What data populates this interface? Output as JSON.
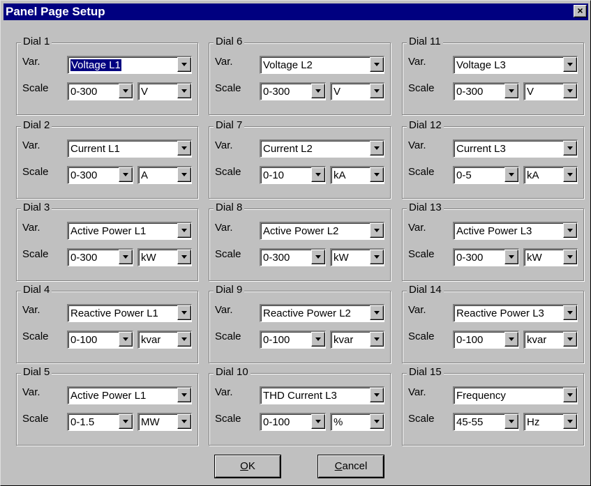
{
  "window": {
    "title": "Panel Page Setup",
    "close_glyph": "×"
  },
  "labels": {
    "var": "Var.",
    "scale": "Scale"
  },
  "dials": [
    {
      "name": "Dial 1",
      "variable": "Voltage L1",
      "range": "0-300",
      "unit": "V",
      "focused": true
    },
    {
      "name": "Dial 2",
      "variable": "Current L1",
      "range": "0-300",
      "unit": "A"
    },
    {
      "name": "Dial 3",
      "variable": "Active Power L1",
      "range": "0-300",
      "unit": "kW"
    },
    {
      "name": "Dial 4",
      "variable": "Reactive Power L1",
      "range": "0-100",
      "unit": "kvar"
    },
    {
      "name": "Dial 5",
      "variable": "Active Power L1",
      "range": "0-1.5",
      "unit": "MW"
    },
    {
      "name": "Dial 6",
      "variable": "Voltage L2",
      "range": "0-300",
      "unit": "V"
    },
    {
      "name": "Dial 7",
      "variable": "Current L2",
      "range": "0-10",
      "unit": "kA"
    },
    {
      "name": "Dial 8",
      "variable": "Active Power L2",
      "range": "0-300",
      "unit": "kW"
    },
    {
      "name": "Dial 9",
      "variable": "Reactive Power L2",
      "range": "0-100",
      "unit": "kvar"
    },
    {
      "name": "Dial 10",
      "variable": "THD Current L3",
      "range": "0-100",
      "unit": "%"
    },
    {
      "name": "Dial 11",
      "variable": "Voltage L3",
      "range": "0-300",
      "unit": "V"
    },
    {
      "name": "Dial 12",
      "variable": "Current L3",
      "range": "0-5",
      "unit": "kA"
    },
    {
      "name": "Dial 13",
      "variable": "Active Power L3",
      "range": "0-300",
      "unit": "kW"
    },
    {
      "name": "Dial 14",
      "variable": "Reactive Power L3",
      "range": "0-100",
      "unit": "kvar"
    },
    {
      "name": "Dial 15",
      "variable": "Frequency",
      "range": "45-55",
      "unit": "Hz"
    }
  ],
  "buttons": {
    "ok": {
      "mnemonic": "O",
      "rest": "K"
    },
    "cancel": {
      "mnemonic": "C",
      "rest": "ancel"
    }
  },
  "colors": {
    "face": "#c0c0c0",
    "title_bar": "#000080",
    "selection": "#000080"
  }
}
